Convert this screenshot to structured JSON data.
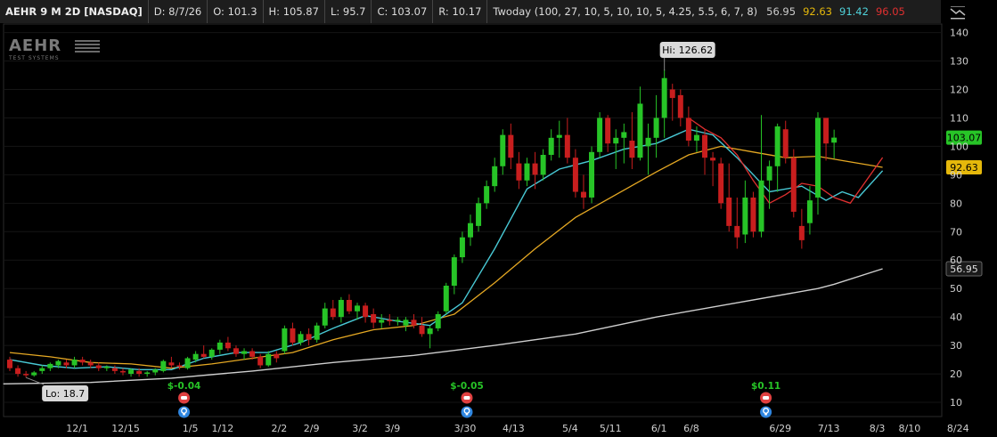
{
  "header": {
    "symbol": "AEHR 9 M 2D [NASDAQ]",
    "date": "D: 8/7/26",
    "open": "O: 101.3",
    "high": "H: 105.87",
    "low": "L: 95.7",
    "close": "C: 103.07",
    "range": "R: 10.17",
    "study": "Twoday (100, 27, 10, 5, 10, 10, 5, 4.25, 5.5, 6, 7, 8)",
    "study_values": [
      {
        "text": "56.95",
        "color": "#cccccc"
      },
      {
        "text": "92.63",
        "color": "#e5b80b"
      },
      {
        "text": "91.42",
        "color": "#4fd1d9"
      },
      {
        "text": "96.05",
        "color": "#e03030"
      }
    ]
  },
  "logo": {
    "main": "AEHR",
    "sub": "TEST SYSTEMS"
  },
  "colors": {
    "up": "#27c427",
    "down": "#c81e1e",
    "ma_slow": "#cfcfcf",
    "ma_mid": "#e5a823",
    "ma_fast": "#48c8d4",
    "ma_red": "#e03030",
    "earnings": "#27c427",
    "event_red": "#e04040",
    "event_blue": "#2f86e0"
  },
  "chart_data": {
    "type": "candlestick",
    "x_ticks": [
      "12/1",
      "12/15",
      "1/5",
      "1/12",
      "2/2",
      "2/9",
      "3/2",
      "3/9",
      "3/30",
      "4/13",
      "5/4",
      "5/11",
      "6/1",
      "6/8",
      "6/29",
      "7/13",
      "8/3",
      "8/10",
      "8/24"
    ],
    "y_ticks": [
      10,
      20,
      30,
      40,
      50,
      60,
      70,
      80,
      90,
      100,
      110,
      120,
      130,
      140
    ],
    "ylim": [
      5,
      143
    ],
    "hi_label": "Hi: 126.62",
    "lo_label": "Lo: 18.7",
    "earnings": [
      {
        "text": "$-0.04",
        "bar": 22
      },
      {
        "text": "$-0.05",
        "bar": 57
      },
      {
        "text": "$0.11",
        "bar": 94
      }
    ],
    "price_tags": [
      {
        "text": "103.07",
        "value": 103.07,
        "bg": "#27c427",
        "fg": "#000000"
      },
      {
        "text": "92.63",
        "value": 92.63,
        "bg": "#e5b80b",
        "fg": "#000000"
      },
      {
        "text": "56.95",
        "value": 56.95,
        "bg": "#1a1a1a",
        "fg": "#dddddd"
      }
    ],
    "candles": [
      [
        25,
        26,
        21,
        22
      ],
      [
        22,
        23,
        19,
        20
      ],
      [
        20,
        21,
        18.7,
        19.5
      ],
      [
        19.5,
        21,
        19,
        20.5
      ],
      [
        21,
        23,
        20,
        22
      ],
      [
        22,
        24,
        21,
        23.5
      ],
      [
        23,
        25,
        22,
        24.5
      ],
      [
        24,
        25,
        22,
        23
      ],
      [
        23,
        26,
        22,
        25
      ],
      [
        25,
        26,
        23,
        24
      ],
      [
        24,
        25,
        22,
        23
      ],
      [
        23,
        24,
        21,
        22
      ],
      [
        22,
        23,
        21,
        22.5
      ],
      [
        22,
        23,
        20,
        21
      ],
      [
        21,
        22,
        19.5,
        20.5
      ],
      [
        20,
        22,
        19,
        21.5
      ],
      [
        21,
        22,
        19,
        20
      ],
      [
        20,
        21,
        19,
        20.5
      ],
      [
        20.5,
        22,
        19.5,
        21.5
      ],
      [
        21,
        25,
        20.5,
        24.5
      ],
      [
        24,
        26,
        22,
        23
      ],
      [
        23,
        24,
        21.5,
        22.5
      ],
      [
        22,
        26,
        21.5,
        25.5
      ],
      [
        25,
        28,
        24,
        27
      ],
      [
        27,
        30,
        25.5,
        26
      ],
      [
        26,
        29,
        25,
        28.5
      ],
      [
        28.5,
        32,
        27,
        31
      ],
      [
        31,
        33,
        28,
        29
      ],
      [
        29,
        30,
        26,
        27
      ],
      [
        27,
        29,
        25,
        28
      ],
      [
        28,
        29,
        25,
        26
      ],
      [
        26,
        27,
        22,
        23
      ],
      [
        23,
        28,
        22.5,
        27
      ],
      [
        27,
        28,
        24,
        25.5
      ],
      [
        28,
        37,
        27,
        36
      ],
      [
        36,
        38,
        30,
        31
      ],
      [
        31,
        35,
        30,
        34
      ],
      [
        34,
        36,
        30,
        32
      ],
      [
        32,
        38,
        31,
        37
      ],
      [
        37,
        45,
        36,
        43
      ],
      [
        43,
        46,
        39,
        40
      ],
      [
        40,
        47,
        38,
        46
      ],
      [
        46,
        48,
        41,
        42
      ],
      [
        42,
        45,
        39,
        44
      ],
      [
        44,
        45,
        38,
        40
      ],
      [
        41,
        43,
        36,
        38
      ],
      [
        38,
        41,
        36,
        39
      ],
      [
        39,
        41,
        37,
        38.5
      ],
      [
        38.5,
        40,
        37,
        39
      ],
      [
        37,
        40,
        35,
        39
      ],
      [
        39,
        41,
        36,
        37
      ],
      [
        37,
        40,
        33,
        34
      ],
      [
        34,
        37,
        29,
        36
      ],
      [
        36,
        42,
        35,
        41
      ],
      [
        42,
        52,
        41,
        51
      ],
      [
        51,
        62,
        48,
        61
      ],
      [
        61,
        70,
        59,
        68
      ],
      [
        68,
        76,
        65,
        73
      ],
      [
        72,
        82,
        70,
        80
      ],
      [
        80,
        88,
        78,
        86
      ],
      [
        86,
        96,
        84,
        93
      ],
      [
        93,
        106,
        90,
        104
      ],
      [
        104,
        108,
        92,
        96
      ],
      [
        94,
        98,
        85,
        88
      ],
      [
        88,
        96,
        86,
        94
      ],
      [
        94,
        98,
        85,
        90
      ],
      [
        90,
        99,
        88,
        97
      ],
      [
        97,
        106,
        95,
        103
      ],
      [
        103,
        109,
        96,
        104
      ],
      [
        104,
        110,
        94,
        96
      ],
      [
        96,
        99,
        82,
        84
      ],
      [
        84,
        90,
        78,
        82
      ],
      [
        82,
        100,
        80,
        98
      ],
      [
        98,
        112,
        96,
        110
      ],
      [
        110,
        111,
        98,
        101
      ],
      [
        101,
        106,
        92,
        103
      ],
      [
        103,
        108,
        94,
        105
      ],
      [
        102,
        112,
        92,
        96
      ],
      [
        96,
        121,
        95,
        115
      ],
      [
        100,
        108,
        90,
        103
      ],
      [
        103,
        118,
        96,
        110
      ],
      [
        110,
        127,
        103,
        124
      ],
      [
        120,
        122,
        109,
        117
      ],
      [
        118,
        120,
        107,
        110
      ],
      [
        110,
        114,
        100,
        102
      ],
      [
        102,
        107,
        98,
        104
      ],
      [
        104,
        106,
        90,
        96
      ],
      [
        96,
        98,
        86,
        95
      ],
      [
        94,
        96,
        78,
        80
      ],
      [
        82,
        94,
        70,
        72
      ],
      [
        72,
        82,
        64,
        68
      ],
      [
        69,
        88,
        66,
        82
      ],
      [
        82,
        84,
        68,
        70
      ],
      [
        70,
        111,
        68,
        88
      ],
      [
        88,
        95,
        78,
        93
      ],
      [
        93,
        108,
        84,
        107
      ],
      [
        106,
        109,
        94,
        96
      ],
      [
        96,
        99,
        75,
        77
      ],
      [
        72,
        78,
        64,
        67
      ],
      [
        73,
        86,
        69,
        81
      ],
      [
        82,
        112,
        76,
        110
      ],
      [
        110,
        109,
        95,
        101
      ],
      [
        101.3,
        105.87,
        95.7,
        103.07
      ]
    ],
    "ma_slow": [
      [
        0,
        16.5
      ],
      [
        10,
        17
      ],
      [
        20,
        18.5
      ],
      [
        30,
        21
      ],
      [
        40,
        24
      ],
      [
        50,
        26.5
      ],
      [
        60,
        30
      ],
      [
        70,
        34
      ],
      [
        80,
        40
      ],
      [
        90,
        45
      ],
      [
        100,
        50
      ],
      [
        102,
        51.5
      ],
      [
        108,
        56.95
      ]
    ],
    "ma_mid": [
      [
        0,
        27.5
      ],
      [
        5,
        26
      ],
      [
        10,
        24
      ],
      [
        15,
        23.5
      ],
      [
        20,
        22
      ],
      [
        25,
        23.5
      ],
      [
        30,
        25.5
      ],
      [
        35,
        27.5
      ],
      [
        40,
        32
      ],
      [
        45,
        35.5
      ],
      [
        50,
        37
      ],
      [
        55,
        41
      ],
      [
        60,
        52
      ],
      [
        65,
        64
      ],
      [
        70,
        75
      ],
      [
        75,
        83
      ],
      [
        80,
        91
      ],
      [
        84,
        97
      ],
      [
        88,
        100
      ],
      [
        92,
        98
      ],
      [
        96,
        96
      ],
      [
        100,
        96.5
      ],
      [
        103,
        95
      ],
      [
        108,
        92.63
      ]
    ],
    "ma_fast": [
      [
        0,
        25
      ],
      [
        4,
        23
      ],
      [
        8,
        22
      ],
      [
        12,
        22.5
      ],
      [
        16,
        21.5
      ],
      [
        20,
        21.5
      ],
      [
        24,
        25.5
      ],
      [
        28,
        27.5
      ],
      [
        32,
        27.5
      ],
      [
        36,
        31
      ],
      [
        40,
        36
      ],
      [
        44,
        40.5
      ],
      [
        48,
        38.5
      ],
      [
        52,
        37
      ],
      [
        56,
        45
      ],
      [
        60,
        64
      ],
      [
        64,
        85
      ],
      [
        68,
        92
      ],
      [
        72,
        95
      ],
      [
        76,
        99
      ],
      [
        80,
        101
      ],
      [
        84,
        106
      ],
      [
        87,
        104
      ],
      [
        90,
        96
      ],
      [
        94,
        84
      ],
      [
        98,
        86
      ],
      [
        101,
        81
      ],
      [
        103,
        84
      ],
      [
        105,
        82
      ],
      [
        108,
        91.42
      ]
    ],
    "ma_red": [
      [
        84,
        110
      ],
      [
        86,
        106
      ],
      [
        88,
        103
      ],
      [
        90,
        97
      ],
      [
        92,
        88
      ],
      [
        94,
        80
      ],
      [
        96,
        83
      ],
      [
        98,
        87
      ],
      [
        100,
        86
      ],
      [
        102,
        82
      ],
      [
        104,
        80
      ],
      [
        106,
        88
      ],
      [
        108,
        96.05
      ]
    ]
  }
}
